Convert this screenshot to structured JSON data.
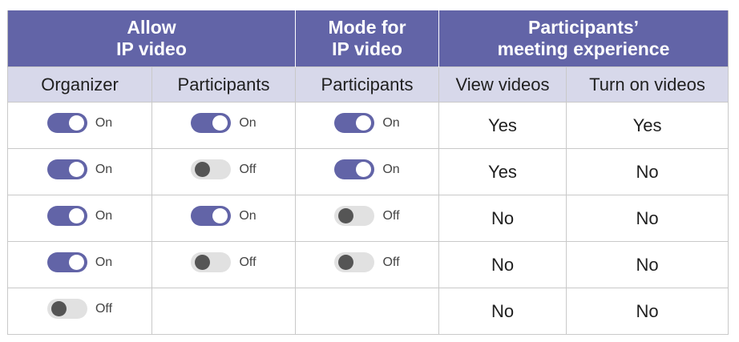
{
  "header": {
    "group1": [
      "Allow",
      "IP video"
    ],
    "group2": [
      "Mode for",
      "IP video"
    ],
    "group3": [
      "Participants’",
      "meeting experience"
    ]
  },
  "columns": [
    "Organizer",
    "Participants",
    "Participants",
    "View videos",
    "Turn on videos"
  ],
  "rows": [
    {
      "organizer": "On",
      "participants": "On",
      "mode": "On",
      "view": "Yes",
      "turn_on": "Yes"
    },
    {
      "organizer": "On",
      "participants": "Off",
      "mode": "On",
      "view": "Yes",
      "turn_on": "No"
    },
    {
      "organizer": "On",
      "participants": "On",
      "mode": "Off",
      "view": "No",
      "turn_on": "No"
    },
    {
      "organizer": "On",
      "participants": "Off",
      "mode": "Off",
      "view": "No",
      "turn_on": "No"
    },
    {
      "organizer": "Off",
      "participants": "",
      "mode": "",
      "view": "No",
      "turn_on": "No"
    }
  ],
  "colors": {
    "accent": "#6264a7",
    "subheader": "#d7d8ea",
    "yes": "#1e9a4a",
    "toggle_off": "#e1e1e1"
  }
}
